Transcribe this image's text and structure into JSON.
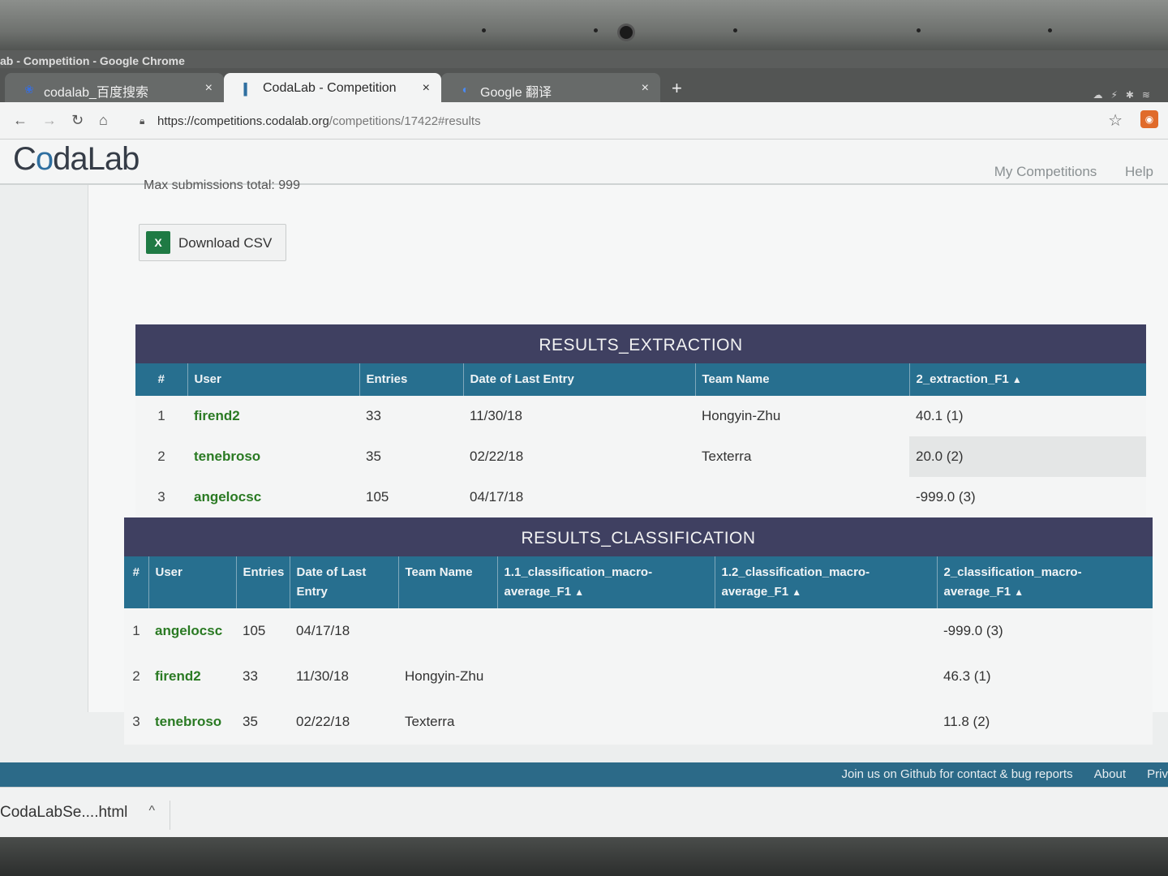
{
  "window": {
    "title": "ab - Competition - Google Chrome"
  },
  "tabs": [
    {
      "label": "codalab_百度搜索",
      "icon": "paw-icon"
    },
    {
      "label": "CodaLab - Competition",
      "icon": "codalab-icon"
    },
    {
      "label": "Google 翻译",
      "icon": "translate-icon"
    }
  ],
  "tab_close": "×",
  "new_tab": "+",
  "address": {
    "base": "https://competitions.codalab.org",
    "path": "/competitions/17422#results"
  },
  "site": {
    "logo_pre": "C",
    "logo_o": "o",
    "logo_post": "daLab",
    "nav": {
      "my_competitions": "My Competitions",
      "help": "Help"
    }
  },
  "cut_text": "Max submissions total: 999",
  "download_csv": {
    "label": "Download CSV",
    "badge": "X"
  },
  "extraction": {
    "title": "RESULTS_EXTRACTION",
    "headers": [
      "#",
      "User",
      "Entries",
      "Date of Last Entry",
      "Team Name",
      "2_extraction_F1"
    ],
    "rows": [
      {
        "rank": "1",
        "user": "firend2",
        "entries": "33",
        "date": "11/30/18",
        "team": "Hongyin-Zhu",
        "score": "40.1 (1)"
      },
      {
        "rank": "2",
        "user": "tenebroso",
        "entries": "35",
        "date": "02/22/18",
        "team": "Texterra",
        "score": "20.0 (2)"
      },
      {
        "rank": "3",
        "user": "angelocsc",
        "entries": "105",
        "date": "04/17/18",
        "team": "",
        "score": "-999.0 (3)"
      }
    ]
  },
  "classification": {
    "title": "RESULTS_CLASSIFICATION",
    "headers": [
      "#",
      "User",
      "Entries",
      "Date of Last Entry",
      "Team Name",
      "1.1_classification_macro-average_F1",
      "1.2_classification_macro-average_F1",
      "2_classification_macro-average_F1"
    ],
    "rows": [
      {
        "rank": "1",
        "user": "angelocsc",
        "entries": "105",
        "date": "04/17/18",
        "team": "",
        "s11": "",
        "s12": "",
        "s2": "-999.0 (3)"
      },
      {
        "rank": "2",
        "user": "firend2",
        "entries": "33",
        "date": "11/30/18",
        "team": "Hongyin-Zhu",
        "s11": "",
        "s12": "",
        "s2": "46.3 (1)"
      },
      {
        "rank": "3",
        "user": "tenebroso",
        "entries": "35",
        "date": "02/22/18",
        "team": "Texterra",
        "s11": "",
        "s12": "",
        "s2": "11.8 (2)"
      }
    ]
  },
  "sort_indicator": "▲",
  "footer": {
    "github": "Join us on Github for contact & bug reports",
    "about": "About",
    "privacy": "Priv"
  },
  "download_shelf": {
    "file": "CodaLabSe....html",
    "caret": "^"
  },
  "colors": {
    "table_title_bg": "#3f4061",
    "header_bg": "#276f8f",
    "user_green": "#2a7a23",
    "footer_bg": "#2c6a88"
  }
}
